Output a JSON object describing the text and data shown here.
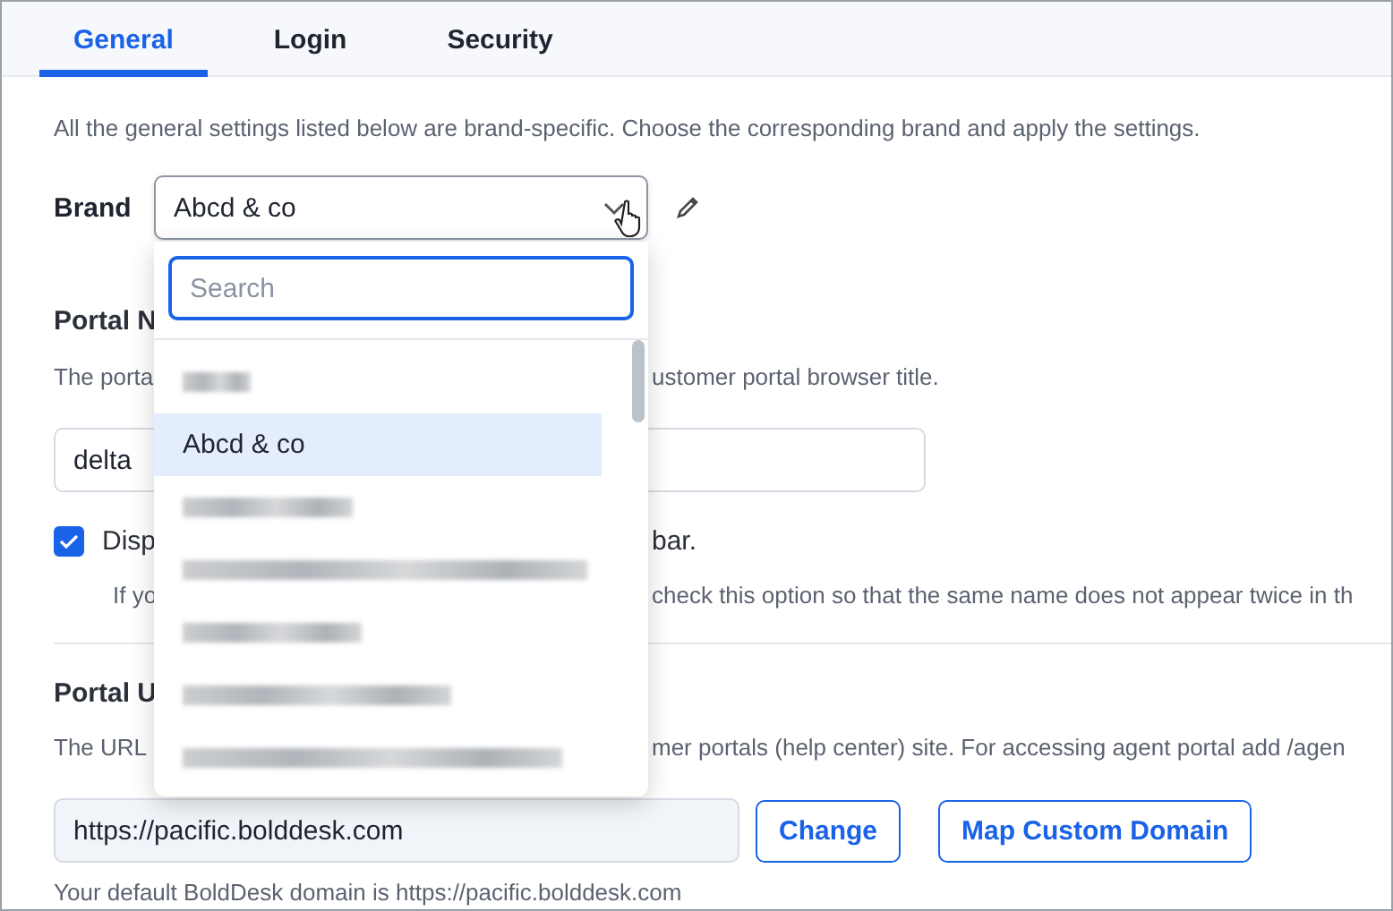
{
  "tabs": [
    {
      "label": "General",
      "selected": true
    },
    {
      "label": "Login",
      "selected": false
    },
    {
      "label": "Security",
      "selected": false
    }
  ],
  "intro": "All the general settings listed below are brand-specific. Choose the corresponding brand and apply the settings.",
  "brand": {
    "label": "Brand",
    "value": "Abcd & co",
    "expanded": true
  },
  "brand_dropdown": {
    "search_placeholder": "Search",
    "options": [
      {
        "kind": "redacted",
        "selected": false
      },
      {
        "kind": "text",
        "label": "Abcd & co",
        "selected": true
      },
      {
        "kind": "redacted",
        "selected": false
      },
      {
        "kind": "redacted",
        "selected": false
      },
      {
        "kind": "redacted",
        "selected": false
      },
      {
        "kind": "redacted",
        "selected": false
      },
      {
        "kind": "redacted",
        "selected": false
      }
    ]
  },
  "portal_name": {
    "heading": "Portal N",
    "description_left": "The porta",
    "description_right": "ustomer portal browser title.",
    "value": "delta",
    "display_option": {
      "checked": true,
      "label_left": "Disp",
      "label_right": "bar."
    },
    "hint_left": "If yo",
    "hint_right": "check this option so that the same name does not appear twice in th"
  },
  "portal_url": {
    "heading": "Portal U",
    "description_left": "The URL",
    "description_right": "mer portals (help center) site. For accessing agent portal add /agen",
    "value": "https://pacific.bolddesk.com",
    "buttons": [
      "Change",
      "Map Custom Domain"
    ],
    "default_domain": "Your default BoldDesk domain is https://pacific.bolddesk.com"
  }
}
